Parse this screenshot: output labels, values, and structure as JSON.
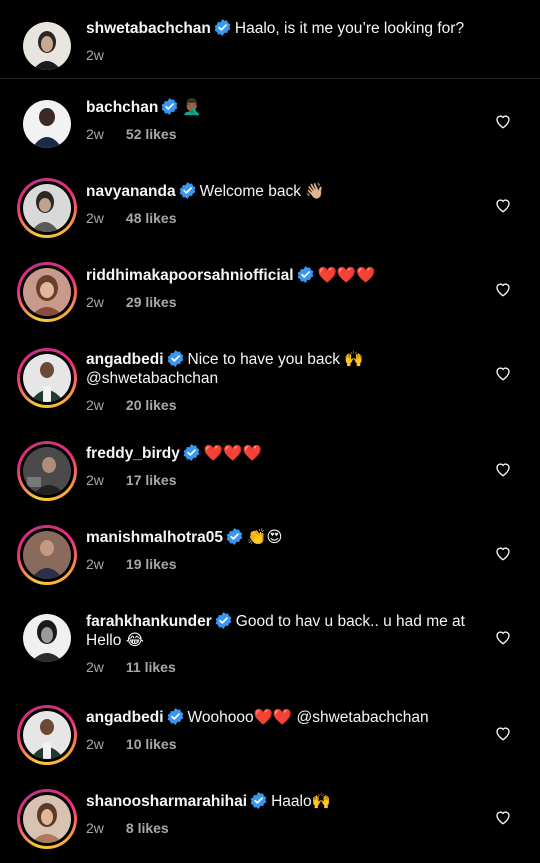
{
  "caption": {
    "username": "shwetabachchan",
    "text": "Haalo, is it me you’re looking for?",
    "time": "2w"
  },
  "comments": [
    {
      "username": "bachchan",
      "text": "🤦🏾‍♂️",
      "time": "2w",
      "likes": "52 likes"
    },
    {
      "username": "navyananda",
      "text": "Welcome back 👋🏼",
      "time": "2w",
      "likes": "48 likes"
    },
    {
      "username": "riddhimakapoorsahniofficial",
      "text": "❤️❤️❤️",
      "time": "2w",
      "likes": "29 likes"
    },
    {
      "username": "angadbedi",
      "text": "Nice to have you back 🙌",
      "text2": "@shwetabachchan",
      "time": "2w",
      "likes": "20 likes"
    },
    {
      "username": "freddy_birdy",
      "text": "❤️❤️❤️",
      "time": "2w",
      "likes": "17 likes"
    },
    {
      "username": "manishmalhotra05",
      "text": "👏😍",
      "time": "2w",
      "likes": "19 likes"
    },
    {
      "username": "farahkhankunder",
      "text": "Good to hav u back.. u had me at",
      "text2": "Hello 😂",
      "time": "2w",
      "likes": "11 likes"
    },
    {
      "username": "angadbedi",
      "text": "Woohooo❤️❤️ @shwetabachchan",
      "time": "2w",
      "likes": "10 likes"
    },
    {
      "username": "shanoosharmarahihai",
      "text": "Haalo🙌",
      "time": "2w",
      "likes": "8 likes"
    }
  ],
  "colors": {
    "background": "#000000",
    "verified": "#3897f0",
    "secondary_text": "#a8a8a8"
  },
  "icons": {
    "verified": "verified-badge-icon",
    "like": "heart-outline-icon"
  }
}
